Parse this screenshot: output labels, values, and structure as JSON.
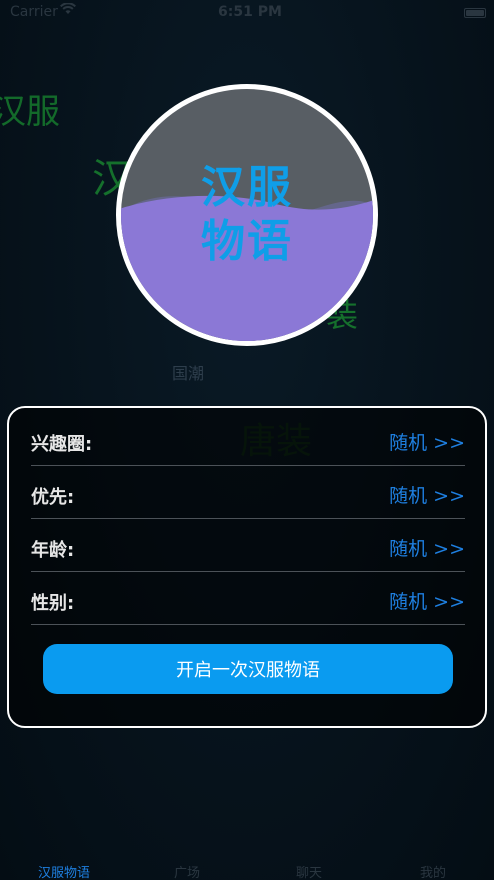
{
  "status_bar": {
    "carrier": "Carrier",
    "wifi_icon": "wifi-icon",
    "time": "6:51 PM",
    "battery_icon": "battery-icon"
  },
  "floating_tags": [
    {
      "text": "汉服",
      "color": "#136a2a"
    },
    {
      "text": "汉服",
      "color": "#15702c"
    },
    {
      "text": "装",
      "color": "#15702c"
    },
    {
      "text": "国潮",
      "color": "#2e3e4c"
    },
    {
      "text": "唐装",
      "color": "#0f2e18"
    }
  ],
  "logo": {
    "title_line1": "汉服",
    "title_line2": "物语",
    "fill_level": 0.55,
    "wave_color": "#8b78d6",
    "title_color": "#0f9ee8"
  },
  "form": {
    "rows": [
      {
        "label": "兴趣圈:",
        "action": "随机 >>"
      },
      {
        "label": "优先:",
        "action": "随机 >>"
      },
      {
        "label": "年龄:",
        "action": "随机 >>"
      },
      {
        "label": "性别:",
        "action": "随机 >>"
      }
    ],
    "submit_label": "开启一次汉服物语"
  },
  "tab_bar": {
    "tabs": [
      {
        "label": "汉服物语",
        "active": true
      },
      {
        "label": "广场",
        "active": false
      },
      {
        "label": "聊天",
        "active": false
      },
      {
        "label": "我的",
        "active": false
      }
    ]
  },
  "colors": {
    "background": "#06121b",
    "accent": "#1e7fe0",
    "button": "#0a9bf0"
  }
}
